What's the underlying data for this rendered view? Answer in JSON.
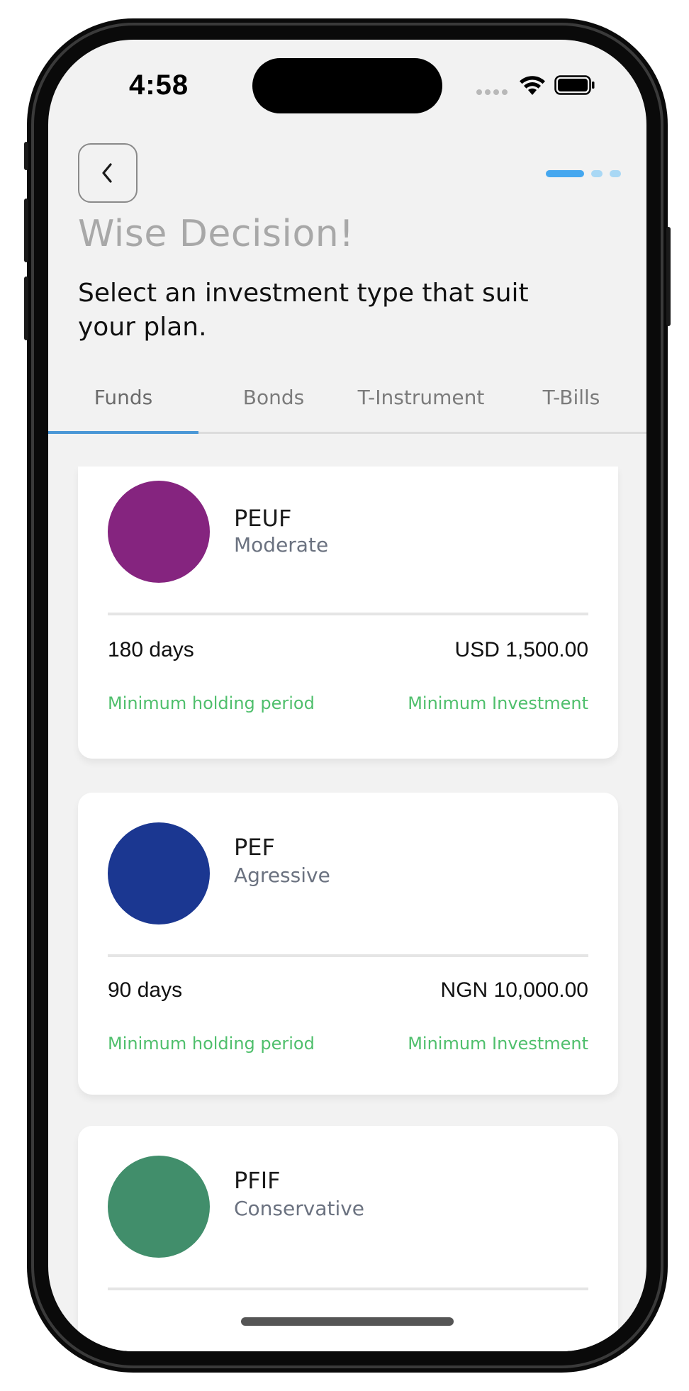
{
  "status_bar": {
    "time": "4:58"
  },
  "header": {
    "title": "Wise Decision!",
    "subtitle": "Select an investment type that suit your plan.",
    "progress_steps": 3,
    "progress_current": 1
  },
  "tabs": [
    {
      "label": "Funds",
      "active": true
    },
    {
      "label": "Bonds",
      "active": false
    },
    {
      "label": "T-Instrument",
      "active": false
    },
    {
      "label": "T-Bills",
      "active": false
    }
  ],
  "funds": [
    {
      "name": "PEUF",
      "risk": "Moderate",
      "color": "#85247f",
      "holding_period": "180 days",
      "holding_label": "Minimum holding period",
      "min_investment": "USD 1,500.00",
      "investment_label": "Minimum Investment"
    },
    {
      "name": "PEF",
      "risk": "Agressive",
      "color": "#1b3791",
      "holding_period": "90 days",
      "holding_label": "Minimum holding period",
      "min_investment": "NGN 10,000.00",
      "investment_label": "Minimum Investment"
    },
    {
      "name": "PFIF",
      "risk": "Conservative",
      "color": "#418e6b"
    }
  ],
  "colors": {
    "accent": "#45a7ef",
    "tab_indicator": "#4a97d6",
    "label_green": "#4fbf6c",
    "background": "#f2f2f2"
  }
}
